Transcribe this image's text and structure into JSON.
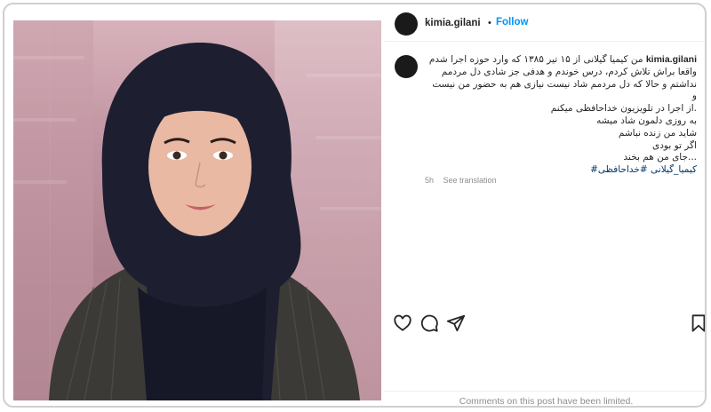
{
  "post": {
    "username": "kimia.gilani",
    "separator": "•",
    "follow_label": "Follow",
    "caption_lines": [
      "من کیمیا گیلانی از ۱۵ تیر ۱۳۸۵ که وارد حوزه اجرا شدم",
      "واقعا براش تلاش کردم، درس خوندم و هدفی جز شادی دل مردمم",
      "نداشتم و حالا که دل مردمم شاد نیست نیازی هم به حضور من نیست و",
      ".از اجرا در تلویزیون خداحافظی میکنم",
      "به روزی دلمون شاد میشه",
      "شاید من زنده نباشم",
      "اگر تو بودی",
      "...جای من هم بخند"
    ],
    "hashtags": "کیمیا_گیلانی #خداحافظی#",
    "time": "5h",
    "see_translation": "See translation",
    "comments_limited": "Comments on this post have been limited."
  },
  "icons": {
    "like": "heart-icon",
    "comment": "comment-icon",
    "share": "share-icon",
    "save": "bookmark-icon"
  }
}
